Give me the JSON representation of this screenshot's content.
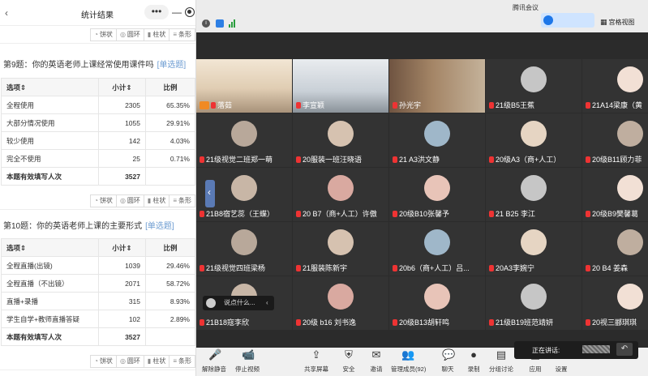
{
  "left_panel": {
    "back_icon": "back-arrow-icon",
    "title": "统计结果",
    "more_dots": "•••",
    "minimize": "—",
    "chart_buttons": [
      "饼状",
      "圆环",
      "柱状",
      "条形"
    ],
    "q9": {
      "title": "第9题：你的英语老师上课经常使用课件吗",
      "tag": "[单选题]",
      "headers": [
        "选项",
        "小计",
        "比例"
      ],
      "rows": [
        {
          "option": "全程使用",
          "count": "2305",
          "ratio": "65.35%"
        },
        {
          "option": "大部分情况使用",
          "count": "1055",
          "ratio": "29.91%"
        },
        {
          "option": "较少使用",
          "count": "142",
          "ratio": "4.03%"
        },
        {
          "option": "完全不使用",
          "count": "25",
          "ratio": "0.71%"
        }
      ],
      "total_label": "本题有效填写人次",
      "total": "3527"
    },
    "q10": {
      "title": "第10题：你的英语老师上课的主要形式",
      "tag": "[单选题]",
      "headers": [
        "选项",
        "小计",
        "比例"
      ],
      "rows": [
        {
          "option": "全程直播(出镜)",
          "count": "1039",
          "ratio": "29.46%"
        },
        {
          "option": "全程直播（不出镜）",
          "count": "2071",
          "ratio": "58.72%"
        },
        {
          "option": "直播+录播",
          "count": "315",
          "ratio": "8.93%"
        },
        {
          "option": "学生自学+教师直播答疑",
          "count": "102",
          "ratio": "2.89%"
        }
      ],
      "total_label": "本题有效填写人次",
      "total": "3527"
    }
  },
  "meeting": {
    "app_title": "腾讯会议",
    "view_label": "宫格视图",
    "participants": [
      "落茹",
      "李宣颖",
      "孙光宇",
      "21级B5王蕉",
      "21A14梁康（黄",
      "21级视觉二班郑一萌",
      "20服装一班汪晓语",
      "21 A3洪文静",
      "20级A3（商+人工）",
      "20级B11顾力菲",
      "21B8宿艺蕊（王蝶）",
      "20 B7（商+人工）许傲",
      "20级B10张馨予",
      "21 B25 李江",
      "20级B9樊馨葛",
      "21级视觉四班梁杨",
      "21服装陈新宇",
      "20b6（商+人工）吕...",
      "20A3李婉宁",
      "20 B4 姜森",
      "21B18寇李欣",
      "20级 b16 刘书逸",
      "20级B13胡轩鸣",
      "21级B19班范靖妍",
      "20视三郦琪琪"
    ],
    "chat_hint": "说点什么...",
    "speaking_label": "正在讲话:",
    "toolbar": [
      {
        "label": "解除静音",
        "icon": "mic-muted-icon"
      },
      {
        "label": "停止视频",
        "icon": "video-camera-icon"
      },
      {
        "label": "共享屏幕",
        "icon": "share-screen-icon"
      },
      {
        "label": "安全",
        "icon": "shield-icon"
      },
      {
        "label": "邀请",
        "icon": "invite-icon"
      },
      {
        "label": "管理成员(92)",
        "icon": "members-icon"
      },
      {
        "label": "聊天",
        "icon": "chat-icon"
      },
      {
        "label": "录制",
        "icon": "record-icon"
      },
      {
        "label": "分组讨论",
        "icon": "breakout-icon"
      },
      {
        "label": "应用",
        "icon": "apps-icon"
      },
      {
        "label": "设置",
        "icon": "settings-icon"
      }
    ]
  }
}
